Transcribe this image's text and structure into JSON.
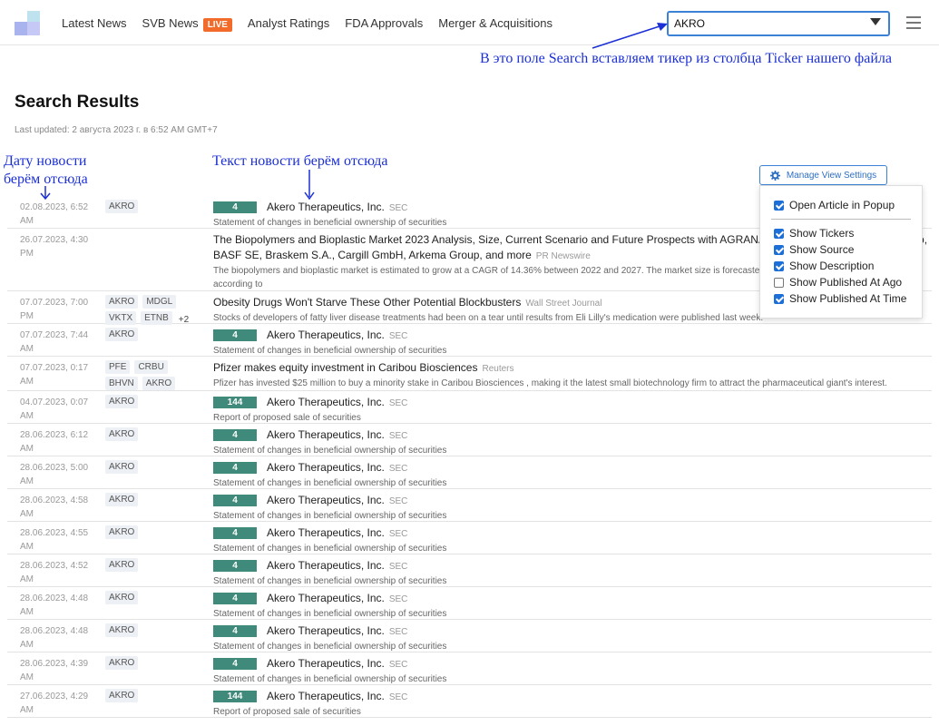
{
  "header": {
    "nav": [
      "Latest News",
      "SVB News",
      "Analyst Ratings",
      "FDA Approvals",
      "Merger & Acquisitions"
    ],
    "live_label": "LIVE",
    "search_value": "AKRO"
  },
  "annotations": {
    "search": "В это поле Search вставляем тикер из столбца Ticker нашего файла",
    "date_line1": "Дату новости",
    "date_line2": "берём отсюда",
    "text": "Текст новости берём отсюда"
  },
  "page": {
    "title": "Search Results",
    "last_updated": "Last updated: 2 августа 2023 г. в 6:52 AM GMT+7"
  },
  "settings": {
    "button_label": "Manage View Settings",
    "options": [
      {
        "label": "Open Article in Popup",
        "checked": true
      },
      {
        "label": "Show Tickers",
        "checked": true
      },
      {
        "label": "Show Source",
        "checked": true
      },
      {
        "label": "Show Description",
        "checked": true
      },
      {
        "label": "Show Published At Ago",
        "checked": false
      },
      {
        "label": "Show Published At Time",
        "checked": true
      }
    ]
  },
  "rows": [
    {
      "date": "02.08.2023, 6:52",
      "time_suffix": "AM",
      "tickers": [
        "AKRO"
      ],
      "more": "",
      "badge": "4",
      "headline": "Akero Therapeutics, Inc.",
      "source": "SEC",
      "desc": "Statement of changes in beneficial ownership of securities"
    },
    {
      "date": "26.07.2023, 4:30",
      "time_suffix": "PM",
      "tickers": [],
      "more": "",
      "badge": "",
      "headline": "The Biopolymers and Bioplastic Market 2023 Analysis, Size, Current Scenario and Future Prospects with AGRANA BEteiligungs-AG, Arkema Group, BASF SE, Braskem S.A., Cargill GmbH, Arkema Group, and more",
      "source": "PR Newswire",
      "desc": "The biopolymers and bioplastic market is estimated to grow at a CAGR of 14.36% between 2022 and 2027. The market size is forecasted to increase by USD 6.21 billion, according to"
    },
    {
      "date": "07.07.2023, 7:00",
      "time_suffix": "PM",
      "tickers": [
        "AKRO",
        "MDGL",
        "VKTX",
        "ETNB"
      ],
      "more": "+2",
      "badge": "",
      "headline": "Obesity Drugs Won't Starve These Other Potential Blockbusters",
      "source": "Wall Street Journal",
      "desc": "Stocks of developers of fatty liver disease treatments had been on a tear until results from Eli Lilly's medication were published last week."
    },
    {
      "date": "07.07.2023, 7:44",
      "time_suffix": "AM",
      "tickers": [
        "AKRO"
      ],
      "more": "",
      "badge": "4",
      "headline": "Akero Therapeutics, Inc.",
      "source": "SEC",
      "desc": "Statement of changes in beneficial ownership of securities"
    },
    {
      "date": "07.07.2023, 0:17",
      "time_suffix": "AM",
      "tickers": [
        "PFE",
        "CRBU",
        "BHVN",
        "AKRO"
      ],
      "more": "",
      "badge": "",
      "headline": "Pfizer makes equity investment in Caribou Biosciences",
      "source": "Reuters",
      "desc": "Pfizer has invested $25 million to buy a minority stake in Caribou Biosciences , making it the latest small biotechnology firm to attract the pharmaceutical giant's interest."
    },
    {
      "date": "04.07.2023, 0:07",
      "time_suffix": "AM",
      "tickers": [
        "AKRO"
      ],
      "more": "",
      "badge": "144",
      "headline": "Akero Therapeutics, Inc.",
      "source": "SEC",
      "desc": "Report of proposed sale of securities"
    },
    {
      "date": "28.06.2023, 6:12",
      "time_suffix": "AM",
      "tickers": [
        "AKRO"
      ],
      "more": "",
      "badge": "4",
      "headline": "Akero Therapeutics, Inc.",
      "source": "SEC",
      "desc": "Statement of changes in beneficial ownership of securities"
    },
    {
      "date": "28.06.2023, 5:00",
      "time_suffix": "AM",
      "tickers": [
        "AKRO"
      ],
      "more": "",
      "badge": "4",
      "headline": "Akero Therapeutics, Inc.",
      "source": "SEC",
      "desc": "Statement of changes in beneficial ownership of securities"
    },
    {
      "date": "28.06.2023, 4:58",
      "time_suffix": "AM",
      "tickers": [
        "AKRO"
      ],
      "more": "",
      "badge": "4",
      "headline": "Akero Therapeutics, Inc.",
      "source": "SEC",
      "desc": "Statement of changes in beneficial ownership of securities"
    },
    {
      "date": "28.06.2023, 4:55",
      "time_suffix": "AM",
      "tickers": [
        "AKRO"
      ],
      "more": "",
      "badge": "4",
      "headline": "Akero Therapeutics, Inc.",
      "source": "SEC",
      "desc": "Statement of changes in beneficial ownership of securities"
    },
    {
      "date": "28.06.2023, 4:52",
      "time_suffix": "AM",
      "tickers": [
        "AKRO"
      ],
      "more": "",
      "badge": "4",
      "headline": "Akero Therapeutics, Inc.",
      "source": "SEC",
      "desc": "Statement of changes in beneficial ownership of securities"
    },
    {
      "date": "28.06.2023, 4:48",
      "time_suffix": "AM",
      "tickers": [
        "AKRO"
      ],
      "more": "",
      "badge": "4",
      "headline": "Akero Therapeutics, Inc.",
      "source": "SEC",
      "desc": "Statement of changes in beneficial ownership of securities"
    },
    {
      "date": "28.06.2023, 4:48",
      "time_suffix": "AM",
      "tickers": [
        "AKRO"
      ],
      "more": "",
      "badge": "4",
      "headline": "Akero Therapeutics, Inc.",
      "source": "SEC",
      "desc": "Statement of changes in beneficial ownership of securities"
    },
    {
      "date": "28.06.2023, 4:39",
      "time_suffix": "AM",
      "tickers": [
        "AKRO"
      ],
      "more": "",
      "badge": "4",
      "headline": "Akero Therapeutics, Inc.",
      "source": "SEC",
      "desc": "Statement of changes in beneficial ownership of securities"
    },
    {
      "date": "27.06.2023, 4:29",
      "time_suffix": "AM",
      "tickers": [
        "AKRO"
      ],
      "more": "",
      "badge": "144",
      "headline": "Akero Therapeutics, Inc.",
      "source": "SEC",
      "desc": "Report of proposed sale of securities"
    }
  ]
}
